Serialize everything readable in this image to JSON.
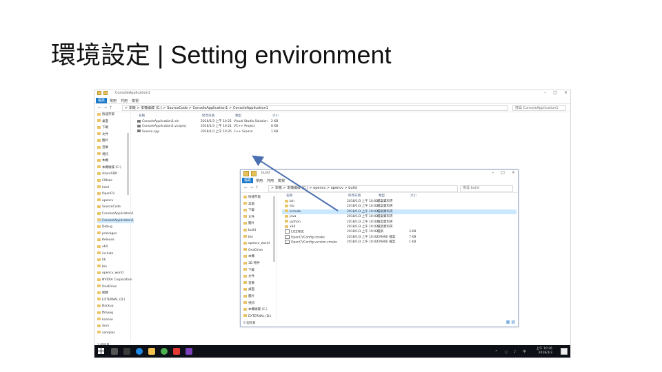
{
  "slide": {
    "title": "環境設定 | Setting environment"
  },
  "colors": {
    "file_tab": "#1979ca",
    "selection": "#cce8ff",
    "arrow": "#4a6fb0",
    "taskbar": "#0d1117"
  },
  "outer": {
    "window_title": "ConsoleApplication1",
    "ribbon": {
      "file": "檔案",
      "tabs": [
        "常用",
        "共用",
        "檢視"
      ]
    },
    "address": "> 本機 > 本機磁碟 (C:) > SourceCode > ConsoleApplication1 > ConsoleApplication1",
    "search_placeholder": "搜尋 ConsoleApplication1",
    "columns": [
      "名稱",
      "修改日期",
      "類型",
      "大小"
    ],
    "sidebar": [
      "快速存取",
      "桌面",
      "下載",
      "文件",
      "圖片",
      "音樂",
      "視訊",
      "本機",
      "本機磁碟 (C:)",
      "AzureSDK",
      "CMake",
      "Intel",
      "OpenCV",
      "opencv",
      "SourceCode",
      "ConsoleApplication1",
      "ConsoleApplication1",
      "Debug",
      "packages",
      "Release",
      "x64",
      "include",
      "lib",
      "bin",
      "opencv_world",
      "NVIDIA Corporation",
      "OneDrive",
      "網路",
      "EXTERNAL (D:)",
      "Backup",
      "ffmpeg",
      "license",
      "docs",
      "samples"
    ],
    "files": [
      {
        "name": "ConsoleApplication1.sln",
        "date": "2018/1/3 上午 10:21",
        "type": "Visual Studio Solution",
        "size": "2 KB"
      },
      {
        "name": "ConsoleApplication1.vcxproj",
        "date": "2018/1/3 上午 10:21",
        "type": "VC++ Project",
        "size": "8 KB"
      },
      {
        "name": "Source.cpp",
        "date": "2018/1/3 上午 10:25",
        "type": "C++ Source",
        "size": "1 KB"
      }
    ],
    "status": "3 個項目",
    "clock": {
      "time": "上午 10:26",
      "date": "2018/1/3"
    }
  },
  "inner": {
    "window_title": "build",
    "ribbon": {
      "file": "檔案",
      "tabs": [
        "常用",
        "共用",
        "檢視"
      ]
    },
    "address": "> 本機 > 本機磁碟 (C:) > opencv > opencv > build",
    "search_placeholder": "搜尋 build",
    "columns": [
      "名稱",
      "修改日期",
      "類型",
      "大小"
    ],
    "sidebar": [
      "快速存取",
      "桌面",
      "下載",
      "文件",
      "圖片",
      "build",
      "bin",
      "opencv_world",
      "OneDrive",
      "本機",
      "3D 物件",
      "下載",
      "文件",
      "音樂",
      "桌面",
      "圖片",
      "視訊",
      "本機磁碟 (C:)",
      "EXTERNAL (D:)"
    ],
    "files": [
      {
        "name": "bin",
        "date": "2018/1/3 上午 10:02",
        "type": "檔案資料夾",
        "size": "",
        "doc": false
      },
      {
        "name": "etc",
        "date": "2018/1/3 上午 10:02",
        "type": "檔案資料夾",
        "size": "",
        "doc": false
      },
      {
        "name": "include",
        "date": "2018/1/3 上午 10:02",
        "type": "檔案資料夾",
        "size": "",
        "doc": false
      },
      {
        "name": "java",
        "date": "2018/1/3 上午 10:02",
        "type": "檔案資料夾",
        "size": "",
        "doc": false
      },
      {
        "name": "python",
        "date": "2018/1/3 上午 10:02",
        "type": "檔案資料夾",
        "size": "",
        "doc": false
      },
      {
        "name": "x64",
        "date": "2018/1/3 上午 10:02",
        "type": "檔案資料夾",
        "size": "",
        "doc": false
      },
      {
        "name": "LICENSE",
        "date": "2018/1/3 上午 10:02",
        "type": "檔案",
        "size": "3 KB",
        "doc": true
      },
      {
        "name": "OpenCVConfig.cmake",
        "date": "2018/1/3 上午 10:02",
        "type": "CMAKE 檔案",
        "size": "7 KB",
        "doc": true
      },
      {
        "name": "OpenCVConfig-version.cmake",
        "date": "2018/1/3 上午 10:02",
        "type": "CMAKE 檔案",
        "size": "1 KB",
        "doc": true
      }
    ],
    "selected_row": 2,
    "status": "9 個項目"
  }
}
